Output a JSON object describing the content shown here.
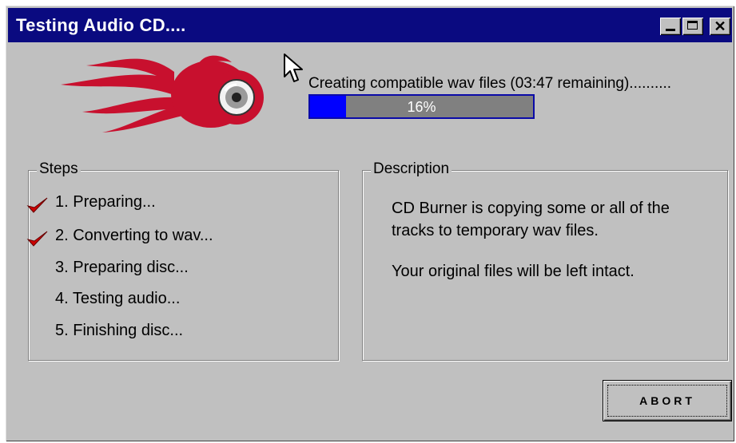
{
  "window": {
    "title": "Testing Audio CD....",
    "controls": {
      "minimize_icon": "minimize-icon",
      "maximize_icon": "maximize-icon",
      "close_glyph": "✕"
    }
  },
  "progress": {
    "status_text": "Creating compatible wav files (03:47 remaining)..........",
    "percent": 16,
    "percent_label": "16%"
  },
  "steps": {
    "legend": "Steps",
    "items": [
      {
        "label": "1. Preparing...",
        "done": true
      },
      {
        "label": "2. Converting to wav...",
        "done": true
      },
      {
        "label": "3. Preparing disc...",
        "done": false
      },
      {
        "label": "4. Testing audio...",
        "done": false
      },
      {
        "label": "5. Finishing disc...",
        "done": false
      }
    ]
  },
  "description": {
    "legend": "Description",
    "lines": [
      "CD Burner is copying some or all of the",
      "tracks to temporary wav files.",
      "",
      "Your original files will be left intact."
    ]
  },
  "buttons": {
    "abort_label": "ABORT"
  },
  "colors": {
    "titlebar": "#0a0a80",
    "window_face": "#c0c0c0",
    "progress_fill": "#0000ff",
    "progress_track": "#808080",
    "logo_red": "#c8102e",
    "check_red": "#cc0000"
  }
}
